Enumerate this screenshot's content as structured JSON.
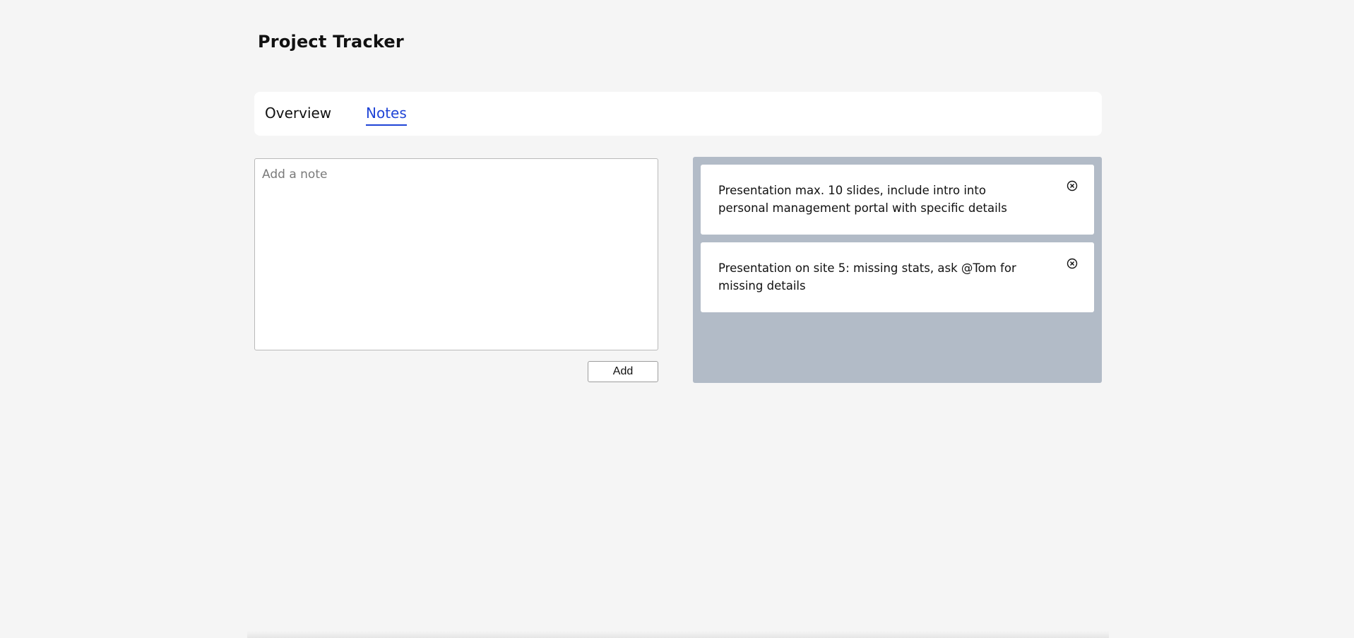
{
  "header": {
    "title": "Project Tracker"
  },
  "tabs": [
    {
      "label": "Overview",
      "active": false
    },
    {
      "label": "Notes",
      "active": true
    }
  ],
  "note_form": {
    "placeholder": "Add a note",
    "value": "",
    "add_label": "Add"
  },
  "notes": [
    {
      "text": "Presentation max. 10 slides, include intro into personal management portal with specific details",
      "icon": "close-circle-icon"
    },
    {
      "text": "Presentation on site 5: missing stats, ask @Tom for missing details",
      "icon": "close-circle-icon"
    }
  ],
  "colors": {
    "background": "#f5f5f5",
    "accent": "#1f44d6",
    "notes_panel": "#b2bbc7",
    "card": "#ffffff"
  }
}
